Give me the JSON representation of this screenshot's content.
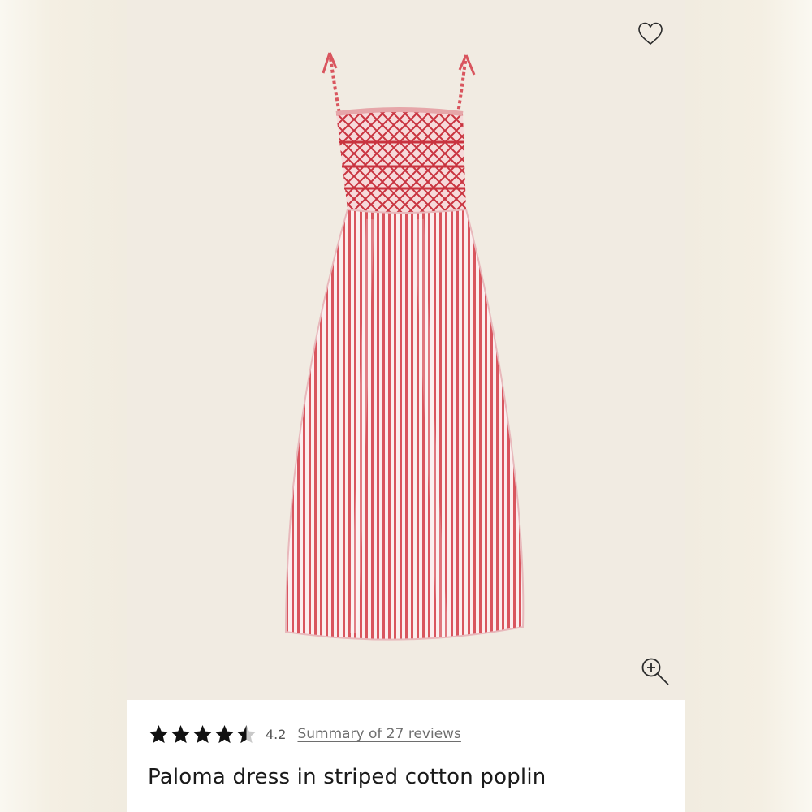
{
  "product": {
    "title": "Paloma dress in striped cotton poplin",
    "rating_value": "4.2",
    "rating_fraction": 0.84,
    "reviews_link": "Summary of 27 reviews",
    "image_background": "#f1ebe2",
    "stripe_color": "#d9555e"
  },
  "icons": {
    "wishlist": "heart-outline-icon",
    "zoom": "zoom-in-icon",
    "star": "star-icon"
  }
}
